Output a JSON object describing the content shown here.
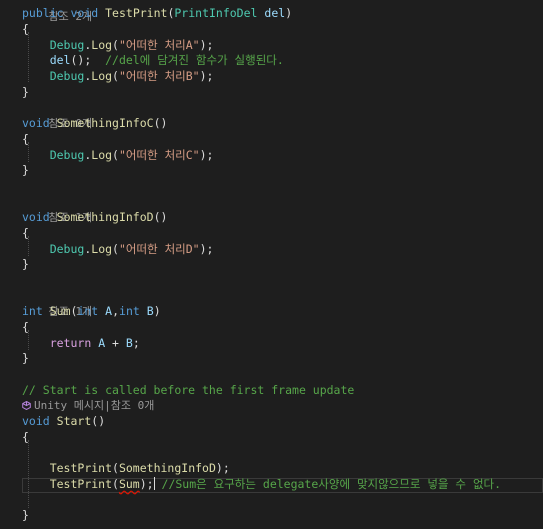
{
  "codelens": {
    "ref_top": "참조 2개",
    "ref_c": "참조 0개",
    "ref_d": "참조 1개",
    "ref_sum": "참조 1개",
    "unity_label": "Unity 메시지|참조 0개"
  },
  "code": {
    "kw_public": "public",
    "kw_void": "void",
    "kw_int": "int",
    "kw_return": "return",
    "fn_testprint": "TestPrint",
    "type_printinfodel": "PrintInfoDel",
    "param_del": "del",
    "open_brace": "{",
    "close_brace": "}",
    "debug": "Debug",
    "log": "Log",
    "str_a": "\"어떠한 처리A\"",
    "str_b": "\"어떠한 처리B\"",
    "str_c": "\"어떠한 처리C\"",
    "str_d": "\"어떠한 처리D\"",
    "del_call": "del",
    "comment_del": "//del에 담겨진 함수가 실행된다.",
    "fn_something_c": "SomethingInfoC",
    "fn_something_d": "SomethingInfoD",
    "fn_sum": "Sum",
    "param_a": "A",
    "param_b": "B",
    "comment_start": "// Start is called before the first frame update",
    "fn_start": "Start",
    "arg_something_d": "SomethingInfoD",
    "arg_sum": "Sum",
    "comment_sum": "//Sum은 요구하는 delegate사양에 맞지않으므로 넣을 수 없다."
  },
  "colors": {
    "background": "#1e1e1e",
    "keyword": "#569cd6",
    "method": "#dcdcaa",
    "type": "#4ec9b0",
    "string": "#d69d85",
    "comment": "#57a64a",
    "control": "#d8a0df",
    "error_squiggle": "#e51400"
  },
  "icons": {
    "unity": "unity-cube-icon"
  }
}
